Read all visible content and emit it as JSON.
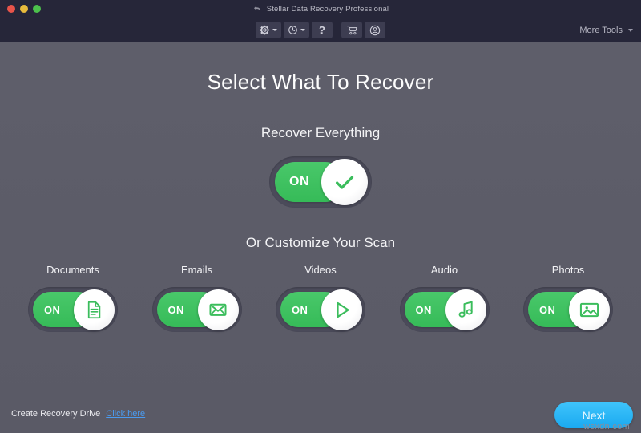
{
  "window": {
    "title": "Stellar Data Recovery Professional",
    "back_icon": "back-arrow-icon",
    "controls": {
      "close": "close-window-button",
      "minimize": "minimize-window-button",
      "maximize": "maximize-window-button"
    },
    "colors": {
      "titlebar": "#262639",
      "body": "#5d5d69",
      "accent_green": "#3bbd5c",
      "accent_blue": "#1aa9f0",
      "link_blue": "#4a9bf0",
      "traffic_red": "#e8544a",
      "traffic_amber": "#e8bb3c",
      "traffic_green": "#4cc14c"
    }
  },
  "toolbar": {
    "settings_label": "",
    "settings_icon": "gear-icon",
    "history_label": "",
    "history_icon": "clock-history-icon",
    "help_label": "?",
    "help_icon": "question-mark-icon",
    "cart_label": "",
    "cart_icon": "shopping-cart-icon",
    "account_label": "",
    "account_icon": "user-account-icon",
    "more_tools_label": "More Tools",
    "more_tools_icon": "chevron-down-icon"
  },
  "main": {
    "page_title": "Select What To Recover",
    "recover_everything_label": "Recover Everything",
    "customize_label": "Or Customize Your Scan",
    "master_toggle": {
      "state_label": "ON",
      "state": "on",
      "icon": "checkmark-icon"
    },
    "categories": [
      {
        "label": "Documents",
        "state_label": "ON",
        "state": "on",
        "icon": "document-icon"
      },
      {
        "label": "Emails",
        "state_label": "ON",
        "state": "on",
        "icon": "envelope-icon"
      },
      {
        "label": "Videos",
        "state_label": "ON",
        "state": "on",
        "icon": "play-triangle-icon"
      },
      {
        "label": "Audio",
        "state_label": "ON",
        "state": "on",
        "icon": "music-note-icon"
      },
      {
        "label": "Photos",
        "state_label": "ON",
        "state": "on",
        "icon": "picture-image-icon"
      }
    ]
  },
  "footer": {
    "recovery_drive_text": "Create Recovery Drive",
    "recovery_drive_link": "Click here",
    "next_label": "Next",
    "watermark": "wsxdn.com"
  }
}
